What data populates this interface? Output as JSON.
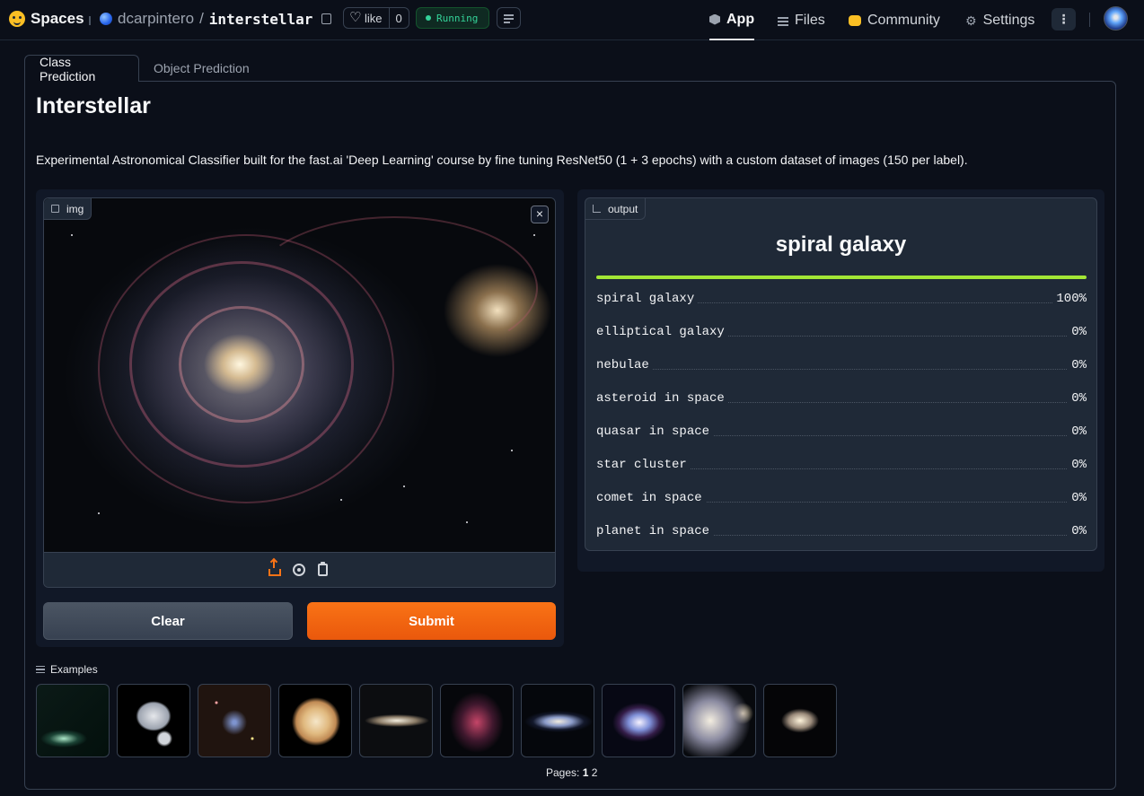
{
  "header": {
    "brand": "Spaces",
    "owner": "dcarpintero",
    "slash": "/",
    "repo": "interstellar",
    "like_label": "like",
    "like_count": "0",
    "status": "Running",
    "nav": [
      {
        "label": "App",
        "icon": "cube-icon",
        "active": true
      },
      {
        "label": "Files",
        "icon": "files-icon",
        "active": false
      },
      {
        "label": "Community",
        "icon": "community-icon",
        "active": false
      },
      {
        "label": "Settings",
        "icon": "gear-icon",
        "active": false
      }
    ],
    "more": "⋮"
  },
  "tabs": [
    "Class Prediction",
    "Object Prediction"
  ],
  "app": {
    "title": "Interstellar",
    "description": "Experimental Astronomical Classifier built for the fast.ai 'Deep Learning' course by fine tuning ResNet50 (1 + 3 epochs) with a custom dataset of images (150 per label).",
    "input_label": "img",
    "close": "×",
    "clear_label": "Clear",
    "submit_label": "Submit",
    "output_label": "output",
    "top_prediction": "spiral galaxy",
    "confidences": [
      {
        "label": "spiral galaxy",
        "value": "100%",
        "fraction": 1.0
      },
      {
        "label": "elliptical galaxy",
        "value": "0%",
        "fraction": 0
      },
      {
        "label": "nebulae",
        "value": "0%",
        "fraction": 0
      },
      {
        "label": "asteroid in space",
        "value": "0%",
        "fraction": 0
      },
      {
        "label": "quasar in space",
        "value": "0%",
        "fraction": 0
      },
      {
        "label": "star cluster",
        "value": "0%",
        "fraction": 0
      },
      {
        "label": "comet in space",
        "value": "0%",
        "fraction": 0
      },
      {
        "label": "planet in space",
        "value": "0%",
        "fraction": 0
      }
    ]
  },
  "examples": {
    "title": "Examples",
    "items": [
      "comet",
      "asteroid",
      "star cluster",
      "jupiter",
      "sombrero galaxy",
      "nebula",
      "andromeda galaxy",
      "spiral galaxy",
      "whirlpool galaxy",
      "spiral galaxy"
    ],
    "pages_label": "Pages:",
    "current_page": "1",
    "other_page": "2"
  },
  "colors": {
    "accent": "#f97316",
    "bar": "#a3e635",
    "running": "#34d399",
    "background": "#0b0f19"
  }
}
